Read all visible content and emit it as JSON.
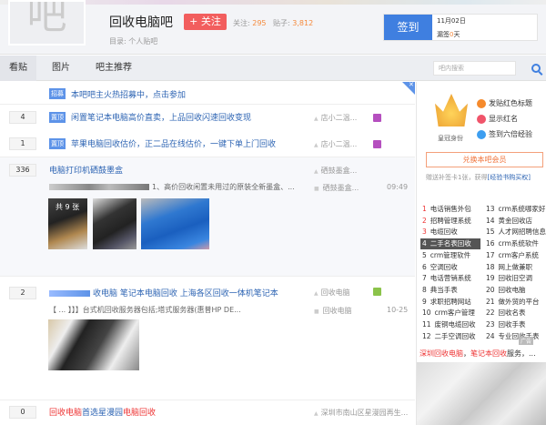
{
  "forum": {
    "logo_char": "吧",
    "title": "回收电脑吧",
    "follow_label": "+ 关注",
    "follow_stat_label": "关注:",
    "follow_count": "295",
    "post_stat_label": "贴子:",
    "post_count": "3,812",
    "directory": "目录:   个人贴吧"
  },
  "sign": {
    "button": "签到",
    "date": "11月02日",
    "missed_prefix": "漏签",
    "missed_days": "0",
    "missed_suffix": "天"
  },
  "nav": {
    "tabs": [
      "看贴",
      "图片",
      "吧主推荐"
    ],
    "search_placeholder": "吧内搜索"
  },
  "threads": [
    {
      "tag": "招募",
      "title": "本吧吧主火热招募中，点击参加"
    },
    {
      "count": "4",
      "tag": "置顶",
      "title": "闲置笔记本电脑高价直卖，上品回收闪速回收变现",
      "author": "店小二温..."
    },
    {
      "count": "1",
      "tag": "置顶",
      "title": "苹果电脑回收估价，正二品在线估价，一键下单上门回收",
      "author": "店小二温..."
    },
    {
      "count": "336",
      "title": "电脑打印机硒鼓墨盒",
      "author": "硒鼓墨盒...",
      "excerpt": "1、高价回收闲置未用过的原装全新墨盒、...",
      "last_reply": "硒鼓墨盒...",
      "time": "09:49",
      "image_count": "共 9 张"
    },
    {
      "count": "2",
      "title": "收电脑 笔记本电脑回收 上海各区回收一体机笔记本",
      "author": "回收电脑",
      "excerpt": "【 ...  】】】台式机回收服务器包括;塔式服务器(惠普HP DE...",
      "last_reply": "回收电脑",
      "time": "10-25"
    },
    {
      "count": "0",
      "title_parts": [
        "回收电脑",
        "首选星漫园",
        "电脑回收"
      ],
      "author": "深圳市南山区星漫园再生..."
    }
  ],
  "sidebar": {
    "crown_label": "皇冠身份",
    "perks": [
      "发贴红色标题",
      "显示红名",
      "签到六倍经验"
    ],
    "exchange_button": "兑换本吧会员",
    "gift_text": "赠送补签卡1张，获得",
    "gift_link": "[经验书购买权]",
    "hot_left": [
      "电话销售外包",
      "招聘管理系统",
      "电缆回收",
      "二手名表回收",
      "crm管理软件",
      "空调回收",
      "电话营销系统",
      "典当手表",
      "求职招聘网站",
      "crm客户管理",
      "废铜电缆回收",
      "二手空调回收"
    ],
    "hot_right": [
      "crm系统哪家好",
      "黄金回收店",
      "人才网招聘信息",
      "crm系统软件",
      "crm客户系统",
      "网上做兼职",
      "回收旧空调",
      "回收电脑",
      "做外贸的平台",
      "回收名表",
      "回收手表",
      "专业回收手表"
    ],
    "ad_tag": "广告",
    "ad_text_red1": "深圳回收电脑",
    "ad_text_mid": "，",
    "ad_text_red2": "笔记本回收",
    "ad_text_end": "服务，..."
  }
}
